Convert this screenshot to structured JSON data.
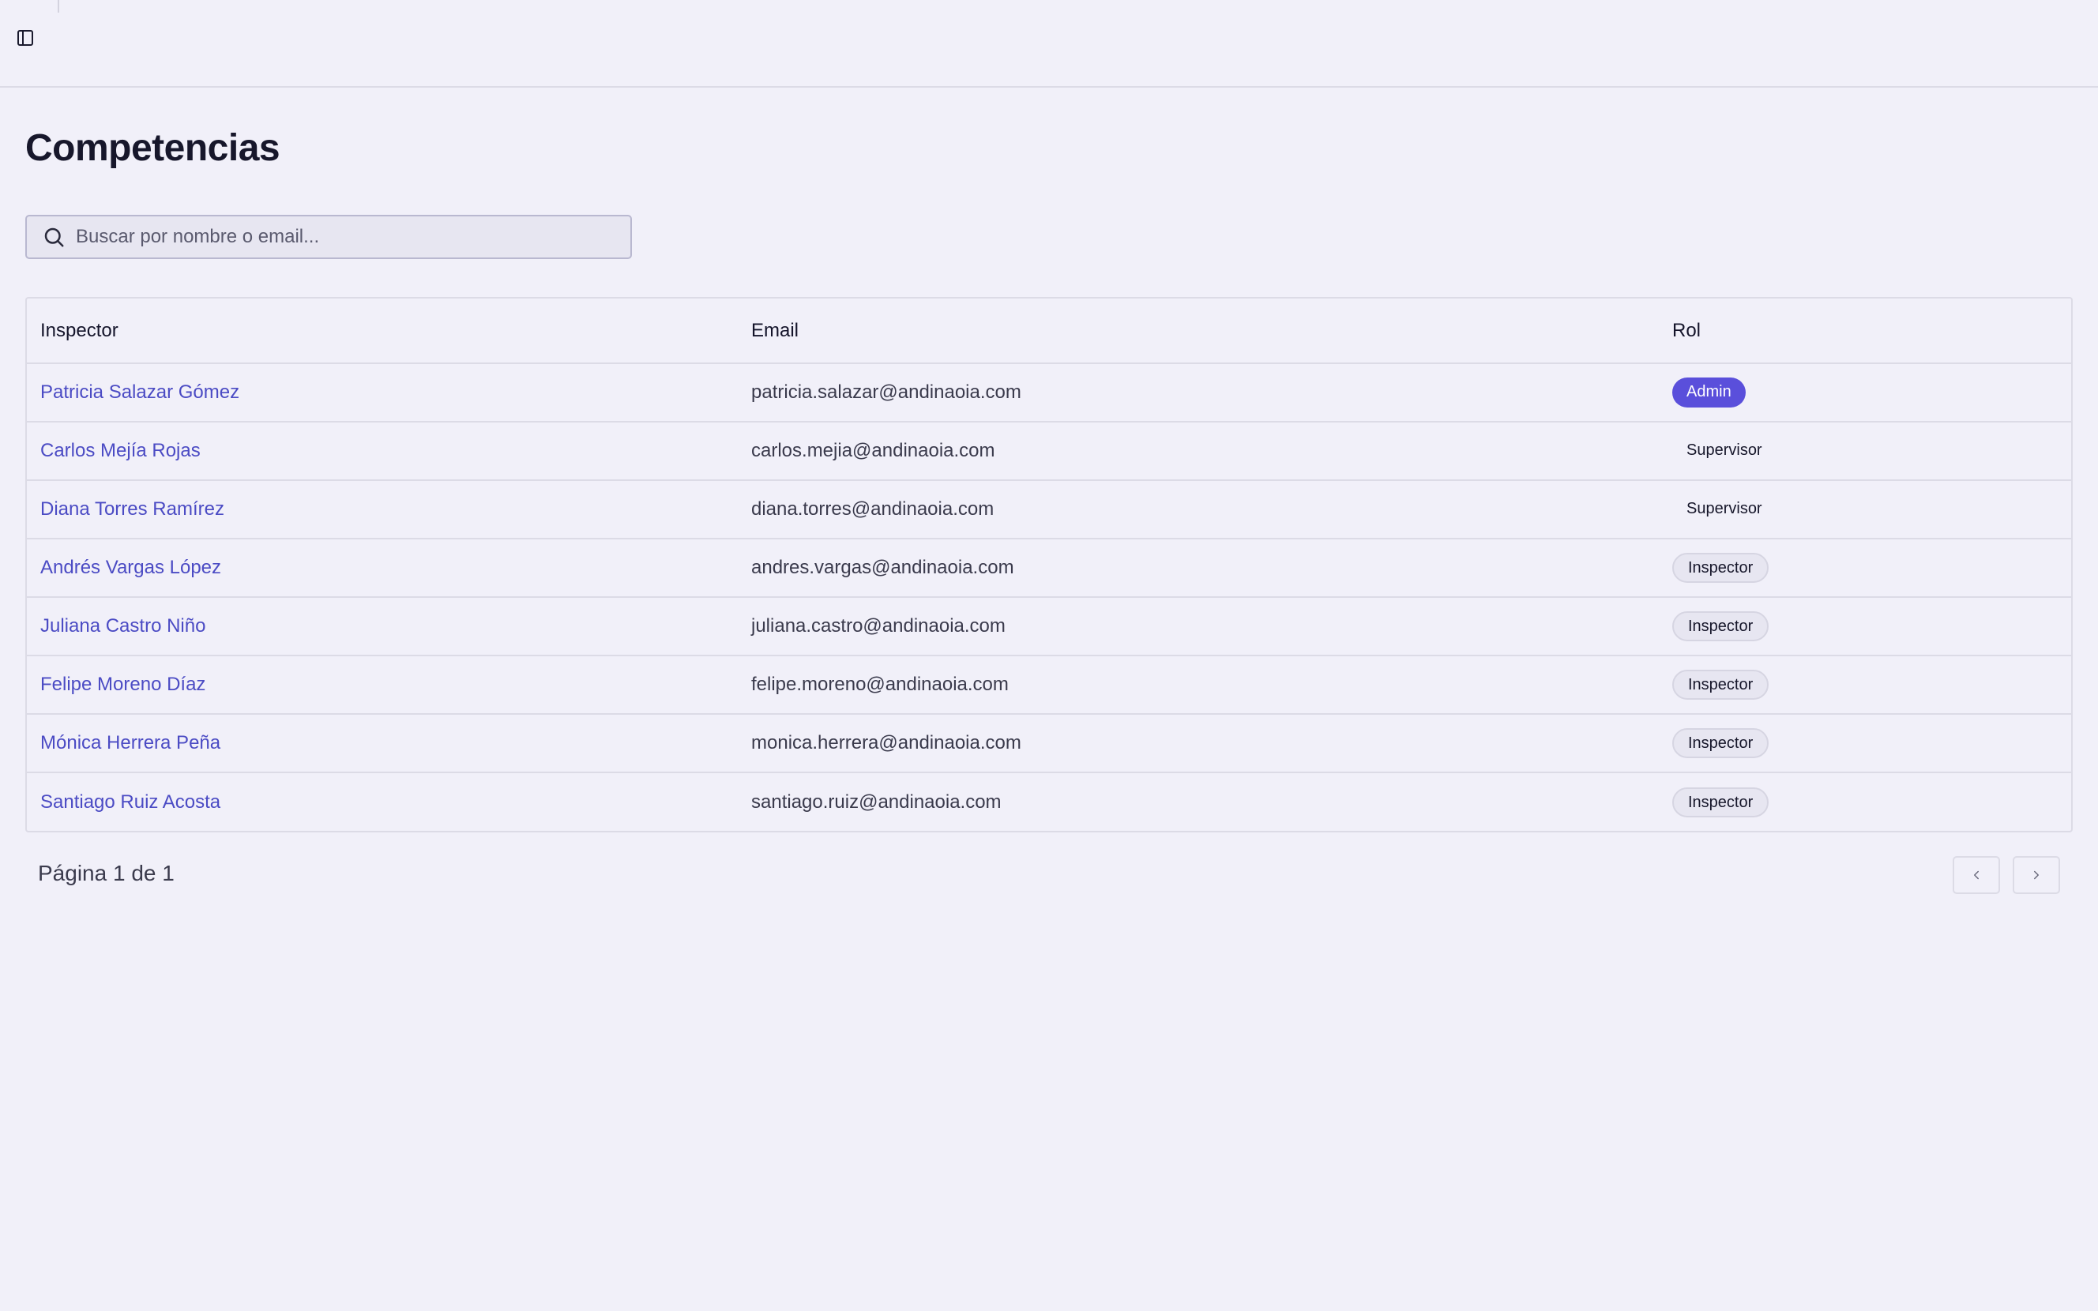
{
  "header": {
    "sidebar_toggle_icon": "panel-left-icon"
  },
  "page": {
    "title": "Competencias"
  },
  "search": {
    "placeholder": "Buscar por nombre o email...",
    "icon": "search-icon"
  },
  "table": {
    "columns": [
      "Inspector",
      "Email",
      "Rol"
    ],
    "rows": [
      {
        "name": "Patricia Salazar Gómez",
        "email": "patricia.salazar@andinaoia.com",
        "role": "Admin",
        "role_type": "admin"
      },
      {
        "name": "Carlos Mejía Rojas",
        "email": "carlos.mejia@andinaoia.com",
        "role": "Supervisor",
        "role_type": "supervisor"
      },
      {
        "name": "Diana Torres Ramírez",
        "email": "diana.torres@andinaoia.com",
        "role": "Supervisor",
        "role_type": "supervisor"
      },
      {
        "name": "Andrés Vargas López",
        "email": "andres.vargas@andinaoia.com",
        "role": "Inspector",
        "role_type": "inspector"
      },
      {
        "name": "Juliana Castro Niño",
        "email": "juliana.castro@andinaoia.com",
        "role": "Inspector",
        "role_type": "inspector"
      },
      {
        "name": "Felipe Moreno Díaz",
        "email": "felipe.moreno@andinaoia.com",
        "role": "Inspector",
        "role_type": "inspector"
      },
      {
        "name": "Mónica Herrera Peña",
        "email": "monica.herrera@andinaoia.com",
        "role": "Inspector",
        "role_type": "inspector"
      },
      {
        "name": "Santiago Ruiz Acosta",
        "email": "santiago.ruiz@andinaoia.com",
        "role": "Inspector",
        "role_type": "inspector"
      }
    ]
  },
  "pagination": {
    "label": "Página 1 de 1",
    "prev_icon": "chevron-left-icon",
    "next_icon": "chevron-right-icon"
  },
  "colors": {
    "background": "#f1f0f9",
    "link": "#4b4bc4",
    "admin_badge": "#5a4fdb",
    "border": "#dcdbe6"
  }
}
